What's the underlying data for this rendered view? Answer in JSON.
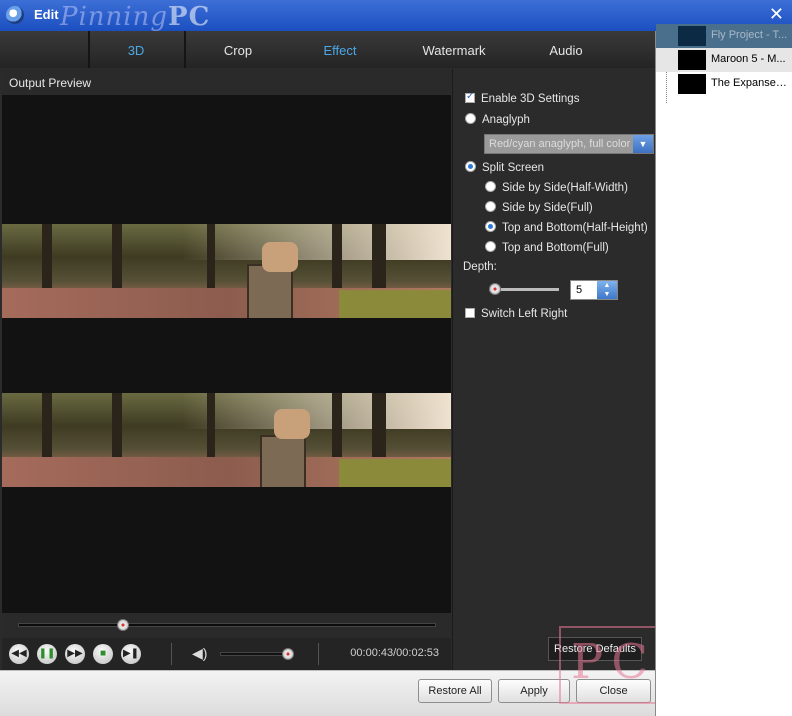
{
  "window": {
    "title": "Edit",
    "watermark_text_1": "Pinning",
    "watermark_text_2": "PC",
    "close_glyph": "✕"
  },
  "tabs": [
    {
      "label": "3D",
      "active": true
    },
    {
      "label": "Crop",
      "active": false
    },
    {
      "label": "Effect",
      "active": false
    },
    {
      "label": "Watermark",
      "active": false
    },
    {
      "label": "Audio",
      "active": false
    }
  ],
  "preview": {
    "label": "Output Preview",
    "time": "00:00:43/00:02:53",
    "seek_progress": 0.25,
    "volume_level": 0.95
  },
  "settings": {
    "enable_3d": {
      "label": "Enable 3D Settings",
      "checked": true
    },
    "anaglyph": {
      "label": "Anaglyph",
      "selected": false
    },
    "anaglyph_dropdown": "Red/cyan anaglyph, full color",
    "split_screen": {
      "label": "Split Screen",
      "selected": true
    },
    "options": [
      {
        "label": "Side by Side(Half-Width)",
        "selected": false
      },
      {
        "label": "Side by Side(Full)",
        "selected": false
      },
      {
        "label": "Top and Bottom(Half-Height)",
        "selected": true
      },
      {
        "label": "Top and Bottom(Full)",
        "selected": false
      }
    ],
    "depth_label": "Depth:",
    "depth_value": "5",
    "switch_left_right": {
      "label": "Switch Left Right",
      "checked": false
    },
    "restore_defaults": "Restore Defaults"
  },
  "footer": {
    "restore_all": "Restore All",
    "apply": "Apply",
    "close": "Close"
  },
  "playlist": [
    {
      "name": "Fly Project - T..."
    },
    {
      "name": "Maroon 5 - M..."
    },
    {
      "name": "The Expanse_..."
    }
  ],
  "watermark_badge": "PC",
  "colors": {
    "accent_tab": "#4aa7e8",
    "titlebar": "#1b4fc0"
  }
}
